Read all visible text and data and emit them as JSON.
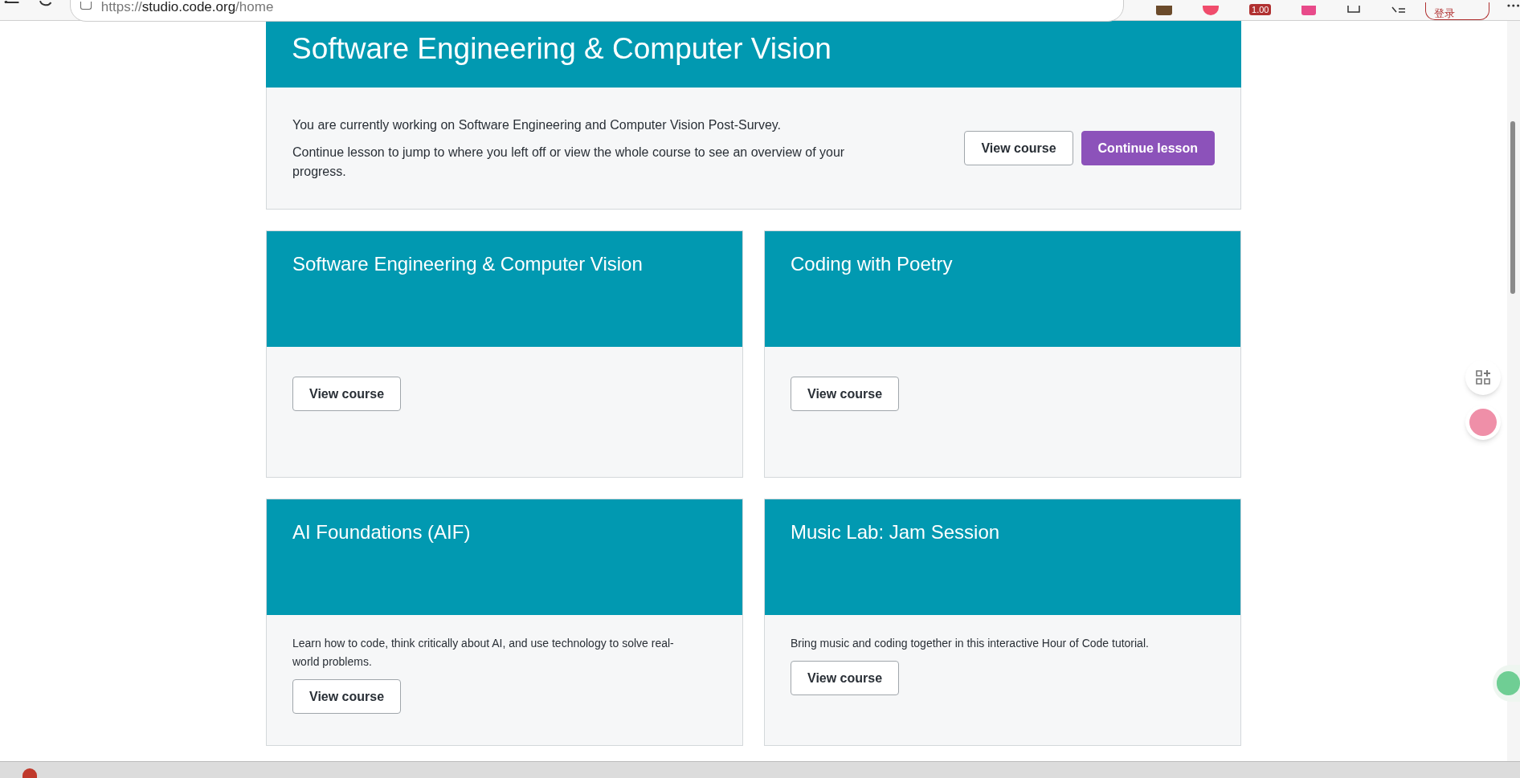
{
  "browser": {
    "url_scheme": "https://",
    "url_host": "studio.code.org",
    "url_path": "/home",
    "extension_badge": "1.00",
    "login_button": "登录"
  },
  "hero": {
    "title": "Software Engineering & Computer Vision",
    "paragraphs": [
      "You are currently working on Software Engineering and Computer Vision Post-Survey.",
      "Continue lesson to jump to where you left off or view the whole course to see an overview of your progress."
    ],
    "buttons": [
      {
        "label": "View course",
        "kind": "secondary"
      },
      {
        "label": "Continue lesson",
        "kind": "primary"
      }
    ]
  },
  "courses": [
    {
      "title": "Software Engineering & Computer Vision",
      "button": "View course"
    },
    {
      "title": "Coding with Poetry",
      "button": "View course"
    },
    {
      "title": "AI Foundations (AIF)",
      "description": "Learn how to code, think critically about AI, and use technology to solve real-world problems.",
      "button": "View course"
    },
    {
      "title": "Music Lab: Jam Session",
      "description": "Bring music and coding together in this interactive Hour of Code tutorial.",
      "button": "View course"
    }
  ]
}
